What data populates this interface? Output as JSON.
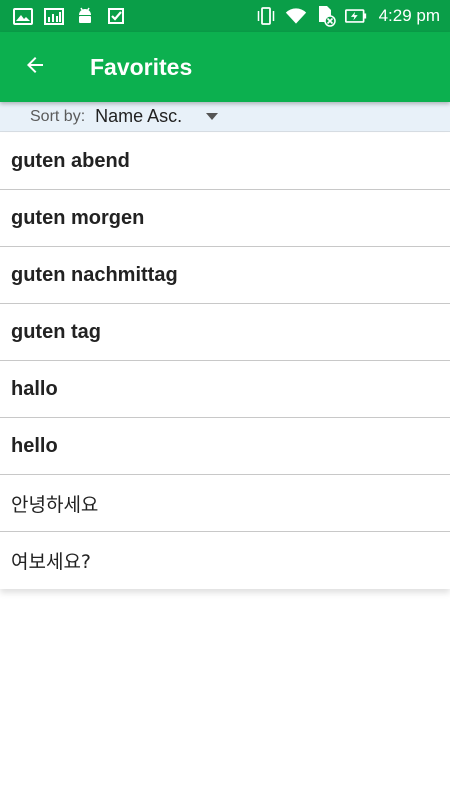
{
  "status_bar": {
    "time": "4:29 pm",
    "left_icons": [
      "image-icon",
      "chart-icon",
      "android-icon",
      "check-icon"
    ],
    "right_icons": [
      "vibrate-icon",
      "wifi-icon",
      "no-sim-icon",
      "battery-charging-icon"
    ]
  },
  "app_bar": {
    "title": "Favorites",
    "color": "#0cb04f"
  },
  "sort": {
    "label": "Sort by:",
    "value": "Name Asc."
  },
  "favorites": [
    {
      "text": "guten abend",
      "style": "bold"
    },
    {
      "text": "guten morgen",
      "style": "bold"
    },
    {
      "text": "guten nachmittag",
      "style": "bold"
    },
    {
      "text": "guten tag",
      "style": "bold"
    },
    {
      "text": "hallo",
      "style": "bold"
    },
    {
      "text": "hello",
      "style": "bold"
    },
    {
      "text": "안녕하세요",
      "style": "regular"
    },
    {
      "text": "여보세요?",
      "style": "regular"
    }
  ]
}
